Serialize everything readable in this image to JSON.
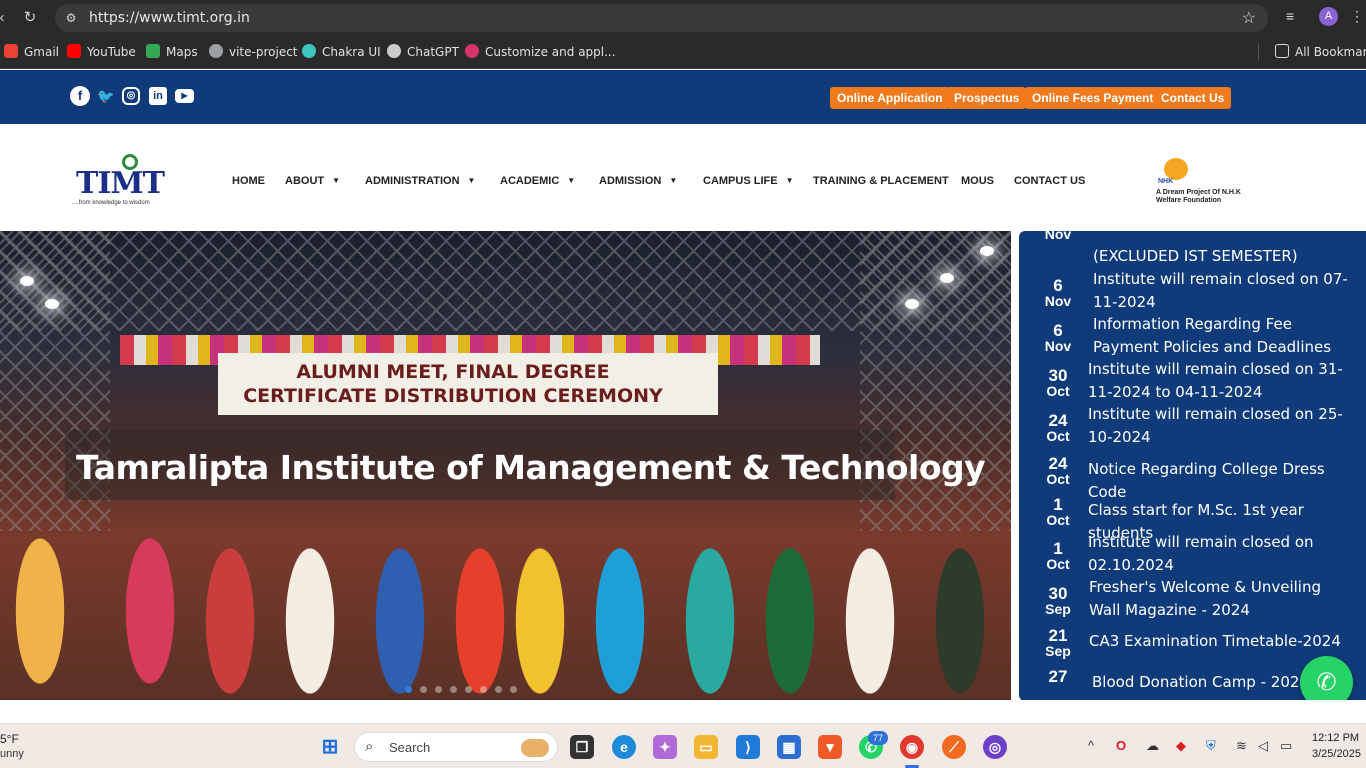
{
  "browser": {
    "url": "https://www.timt.org.in",
    "profile_initial": "A",
    "bookmarks": [
      {
        "label": "Gmail",
        "color": "#ea4335"
      },
      {
        "label": "YouTube",
        "color": "#ff0000"
      },
      {
        "label": "Maps",
        "color": "#34a853"
      },
      {
        "label": "vite-project",
        "color": "#9aa0a6"
      },
      {
        "label": "Chakra UI",
        "color": "#3ec7c2"
      },
      {
        "label": "ChatGPT",
        "color": "#cccccc"
      },
      {
        "label": "Customize and appl...",
        "color": "#d6336c"
      }
    ],
    "all_bookmarks": "All Bookmarks"
  },
  "topbar": {
    "buttons": [
      "Online Application",
      "Prospectus",
      "Online Fees Payment",
      "Contact Us"
    ]
  },
  "header": {
    "logo_text": "TIMT",
    "logo_tagline": "....from knowledge to wisdom",
    "nav": [
      "HOME",
      "ABOUT",
      "ADMINISTRATION",
      "ACADEMIC",
      "ADMISSION",
      "CAMPUS LIFE",
      "TRAINING & PLACEMENT",
      "MOUS",
      "CONTACT US"
    ],
    "partner_label": "NHK",
    "partner_tagline": "A Dream Project Of N.H.K Welfare Foundation"
  },
  "hero": {
    "banner_line1": "ALUMNI MEET, FINAL DEGREE",
    "banner_line2": "CERTIFICATE DISTRIBUTION CEREMONY",
    "title": "Tamralipta Institute of Management & Technology",
    "slide_count": 8,
    "active_slide": 1
  },
  "notices": [
    {
      "day": "",
      "month": "Nov",
      "text": "(EXCLUDED IST SEMESTER)"
    },
    {
      "day": "6",
      "month": "Nov",
      "text": "Institute will remain closed on 07-11-2024"
    },
    {
      "day": "6",
      "month": "Nov",
      "text": "Information Regarding Fee Payment Policies and Deadlines"
    },
    {
      "day": "30",
      "month": "Oct",
      "text": "Institute will remain closed on 31-11-2024 to 04-11-2024"
    },
    {
      "day": "24",
      "month": "Oct",
      "text": "Institute will remain closed on 25-10-2024"
    },
    {
      "day": "24",
      "month": "Oct",
      "text": "Notice Regarding College Dress Code"
    },
    {
      "day": "1",
      "month": "Oct",
      "text": "Class start for M.Sc. 1st year students"
    },
    {
      "day": "1",
      "month": "Oct",
      "text": "Institute will remain closed on 02.10.2024"
    },
    {
      "day": "30",
      "month": "Sep",
      "text": "Fresher's Welcome & Unveiling Wall Magazine - 2024"
    },
    {
      "day": "21",
      "month": "Sep",
      "text": "CA3 Examination Timetable-2024"
    },
    {
      "day": "27",
      "month": "",
      "text": "Blood Donation Camp - 2024"
    }
  ],
  "taskbar": {
    "weather_temp": "5°F",
    "weather_cond": "unny",
    "search_placeholder": "Search",
    "whatsapp_badge": "77",
    "time": "12:12 PM",
    "date": "3/25/2025"
  },
  "colors": {
    "brand_blue": "#0f3b7a",
    "accent_orange": "#f07a1c",
    "whatsapp_green": "#25d366"
  }
}
